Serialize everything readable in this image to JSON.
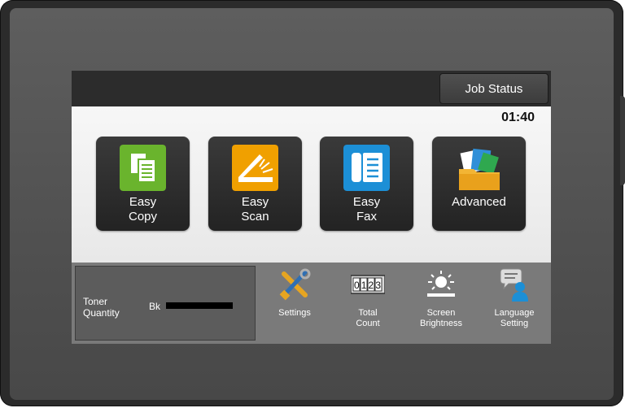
{
  "header": {
    "job_status_label": "Job Status",
    "clock": "01:40"
  },
  "apps": [
    {
      "line1": "Easy",
      "line2": "Copy",
      "icon": "copy-icon",
      "color": "#6ab42d"
    },
    {
      "line1": "Easy",
      "line2": "Scan",
      "icon": "scan-icon",
      "color": "#f0a000"
    },
    {
      "line1": "Easy",
      "line2": "Fax",
      "icon": "fax-icon",
      "color": "#1c8fd6"
    },
    {
      "line1": "Advanced",
      "line2": "",
      "icon": "advanced-folder-icon",
      "color": "#f3b534"
    }
  ],
  "status": {
    "toner_label_line1": "Toner",
    "toner_label_line2": "Quantity",
    "toner_color": "Bk",
    "toner_level": 1.0
  },
  "tools": [
    {
      "line1": "Settings",
      "line2": "",
      "icon": "settings-tools-icon"
    },
    {
      "line1": "Total",
      "line2": "Count",
      "icon": "counter-icon",
      "counter_digits": "0123"
    },
    {
      "line1": "Screen",
      "line2": "Brightness",
      "icon": "brightness-icon"
    },
    {
      "line1": "Language",
      "line2": "Setting",
      "icon": "language-icon"
    }
  ]
}
